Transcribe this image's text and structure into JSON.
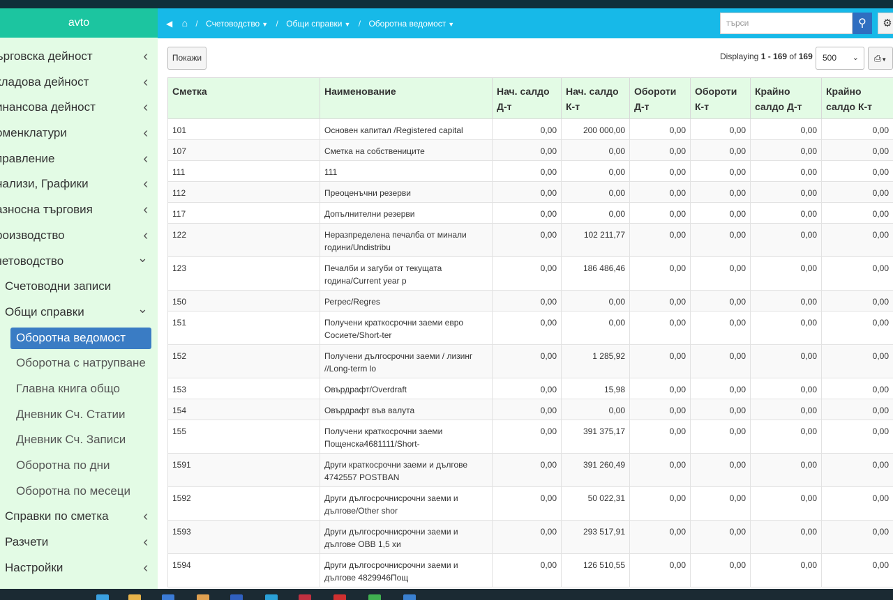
{
  "sidebar": {
    "brand": "avto",
    "items": [
      {
        "label": "ърговска дейност",
        "level": 0,
        "chev": "‹"
      },
      {
        "label": "кладова дейност",
        "level": 0,
        "chev": "‹"
      },
      {
        "label": "инансова дейност",
        "level": 0,
        "chev": "‹"
      },
      {
        "label": "оменклатури",
        "level": 0,
        "chev": "‹"
      },
      {
        "label": "правление",
        "level": 0,
        "chev": "‹"
      },
      {
        "label": "нализи, Графики",
        "level": 0,
        "chev": "‹"
      },
      {
        "label": "азносна търговия",
        "level": 0,
        "chev": "‹"
      },
      {
        "label": "роизводство",
        "level": 0,
        "chev": "‹"
      },
      {
        "label": "четоводство",
        "level": 0,
        "chev": "⌄"
      },
      {
        "label": "Счетоводни записи",
        "level": 1,
        "chev": ""
      },
      {
        "label": "Общи справки",
        "level": 1,
        "chev": "⌄"
      },
      {
        "label": "Оборотна ведомост",
        "level": 2,
        "chev": "",
        "active": true
      },
      {
        "label": "Оборотна с натрупване",
        "level": 2,
        "chev": ""
      },
      {
        "label": "Главна книга общо",
        "level": 2,
        "chev": ""
      },
      {
        "label": "Дневник Сч. Статии",
        "level": 2,
        "chev": ""
      },
      {
        "label": "Дневник Сч. Записи",
        "level": 2,
        "chev": ""
      },
      {
        "label": "Оборотна по дни",
        "level": 2,
        "chev": ""
      },
      {
        "label": "Оборотна по месеци",
        "level": 2,
        "chev": ""
      },
      {
        "label": "Справки по сметка",
        "level": 1,
        "chev": "‹"
      },
      {
        "label": "Разчети",
        "level": 1,
        "chev": "‹"
      },
      {
        "label": "Настройки",
        "level": 1,
        "chev": "‹"
      }
    ]
  },
  "breadcrumb": {
    "items": [
      "Счетоводство",
      "Общи справки",
      "Оборотна ведомост"
    ]
  },
  "search": {
    "placeholder": "търси"
  },
  "toolbar": {
    "show_label": "Покажи",
    "displaying_prefix": "Displaying ",
    "displaying_range": "1 - 169",
    "displaying_of": " of ",
    "displaying_total": "169",
    "page_size": "500"
  },
  "table": {
    "headers": [
      "Сметка",
      "Наименование",
      "Нач. салдо Д-т",
      "Нач. салдо К-т",
      "Обороти Д-т",
      "Обороти К-т",
      "Крайно салдо Д-т",
      "Крайно салдо К-т"
    ],
    "rows": [
      [
        "101",
        "Основен капитал /Registered capital",
        "0,00",
        "200 000,00",
        "0,00",
        "0,00",
        "0,00",
        "0,00"
      ],
      [
        "107",
        "Сметка на собствениците",
        "0,00",
        "0,00",
        "0,00",
        "0,00",
        "0,00",
        "0,00"
      ],
      [
        "111",
        "111",
        "0,00",
        "0,00",
        "0,00",
        "0,00",
        "0,00",
        "0,00"
      ],
      [
        "112",
        "Преоценъчни резерви",
        "0,00",
        "0,00",
        "0,00",
        "0,00",
        "0,00",
        "0,00"
      ],
      [
        "117",
        "Допълнителни резерви",
        "0,00",
        "0,00",
        "0,00",
        "0,00",
        "0,00",
        "0,00"
      ],
      [
        "122",
        "Неразпределена печалба от минали години/Undistribu",
        "0,00",
        "102 211,77",
        "0,00",
        "0,00",
        "0,00",
        "0,00"
      ],
      [
        "123",
        "Печалби и загуби от текущата година/Current year p",
        "0,00",
        "186 486,46",
        "0,00",
        "0,00",
        "0,00",
        "0,00"
      ],
      [
        "150",
        "Регрес/Regres",
        "0,00",
        "0,00",
        "0,00",
        "0,00",
        "0,00",
        "0,00"
      ],
      [
        "151",
        "Получени краткосрочни заеми евро Сосиете/Short-ter",
        "0,00",
        "0,00",
        "0,00",
        "0,00",
        "0,00",
        "0,00"
      ],
      [
        "152",
        "Получени дългосрочни заеми / лизинг //Long-term lo",
        "0,00",
        "1 285,92",
        "0,00",
        "0,00",
        "0,00",
        "0,00"
      ],
      [
        "153",
        "Овърдрафт/Overdraft",
        "0,00",
        "15,98",
        "0,00",
        "0,00",
        "0,00",
        "0,00"
      ],
      [
        "154",
        "Овърдрафт във валута",
        "0,00",
        "0,00",
        "0,00",
        "0,00",
        "0,00",
        "0,00"
      ],
      [
        "155",
        "Получени краткосрочни заеми Пощенска4681111/Short-",
        "0,00",
        "391 375,17",
        "0,00",
        "0,00",
        "0,00",
        "0,00"
      ],
      [
        "1591",
        "Други краткосрочни заеми и дългове 4742557 POSTBAN",
        "0,00",
        "391 260,49",
        "0,00",
        "0,00",
        "0,00",
        "0,00"
      ],
      [
        "1592",
        "Други дългосрочнисрочни заеми и дългове/Other shor",
        "0,00",
        "50 022,31",
        "0,00",
        "0,00",
        "0,00",
        "0,00"
      ],
      [
        "1593",
        "Други дългосрочнисрочни заеми и дългове OBB 1,5 хи",
        "0,00",
        "293 517,91",
        "0,00",
        "0,00",
        "0,00",
        "0,00"
      ],
      [
        "1594",
        "Други дългосрочнисрочни заеми и дългове 4829946Пощ",
        "0,00",
        "126 510,55",
        "0,00",
        "0,00",
        "0,00",
        "0,00"
      ]
    ]
  },
  "colors": {
    "topbar": "#17b9e8",
    "brand": "#1cc5a0",
    "sidebar": "#e3fbe5",
    "active": "#3a7cc4"
  }
}
